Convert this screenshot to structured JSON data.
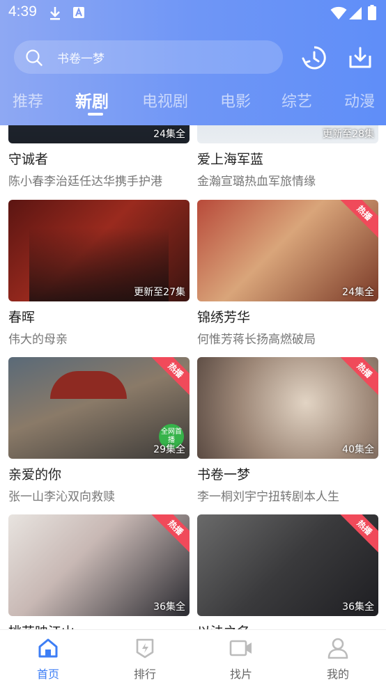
{
  "status": {
    "time": "4:39"
  },
  "search": {
    "placeholder": "书卷一梦"
  },
  "tabs": [
    {
      "label": "推荐"
    },
    {
      "label": "新剧"
    },
    {
      "label": "电视剧"
    },
    {
      "label": "电影"
    },
    {
      "label": "综艺"
    },
    {
      "label": "动漫"
    }
  ],
  "active_tab": "新剧",
  "cards": [
    {
      "title": "守诚者",
      "subtitle": "陈小春李治廷任达华携手护港",
      "episodes": "24集全",
      "hot": false
    },
    {
      "title": "爱上海军蓝",
      "subtitle": "金瀚宣璐热血军旅情缘",
      "episodes": "更新至28集",
      "hot": false
    },
    {
      "title": "春晖",
      "subtitle": "伟大的母亲",
      "episodes": "更新至27集",
      "hot": false
    },
    {
      "title": "锦绣芳华",
      "subtitle": "何惟芳蒋长扬高燃破局",
      "episodes": "24集全",
      "hot": true
    },
    {
      "title": "亲爱的你",
      "subtitle": "张一山李沁双向救赎",
      "episodes": "29集全",
      "hot": true
    },
    {
      "title": "书卷一梦",
      "subtitle": "李一桐刘宇宁扭转剧本人生",
      "episodes": "40集全",
      "hot": true
    },
    {
      "title": "桃花映江山",
      "subtitle": "",
      "episodes": "36集全",
      "hot": true
    },
    {
      "title": "以法之名",
      "subtitle": "",
      "episodes": "36集全",
      "hot": true
    }
  ],
  "ribbon_text": "热播",
  "badge_text": "全网首播",
  "bottom_nav": [
    {
      "label": "首页",
      "icon": "home-icon",
      "active": true
    },
    {
      "label": "排行",
      "icon": "ranking-icon",
      "active": false
    },
    {
      "label": "找片",
      "icon": "video-camera-icon",
      "active": false
    },
    {
      "label": "我的",
      "icon": "profile-icon",
      "active": false
    }
  ],
  "colors": {
    "accent": "#3d7ef5",
    "header_start": "#8ea8f3",
    "header_end": "#5f8ef8",
    "hot_ribbon": "#f04a5a"
  }
}
